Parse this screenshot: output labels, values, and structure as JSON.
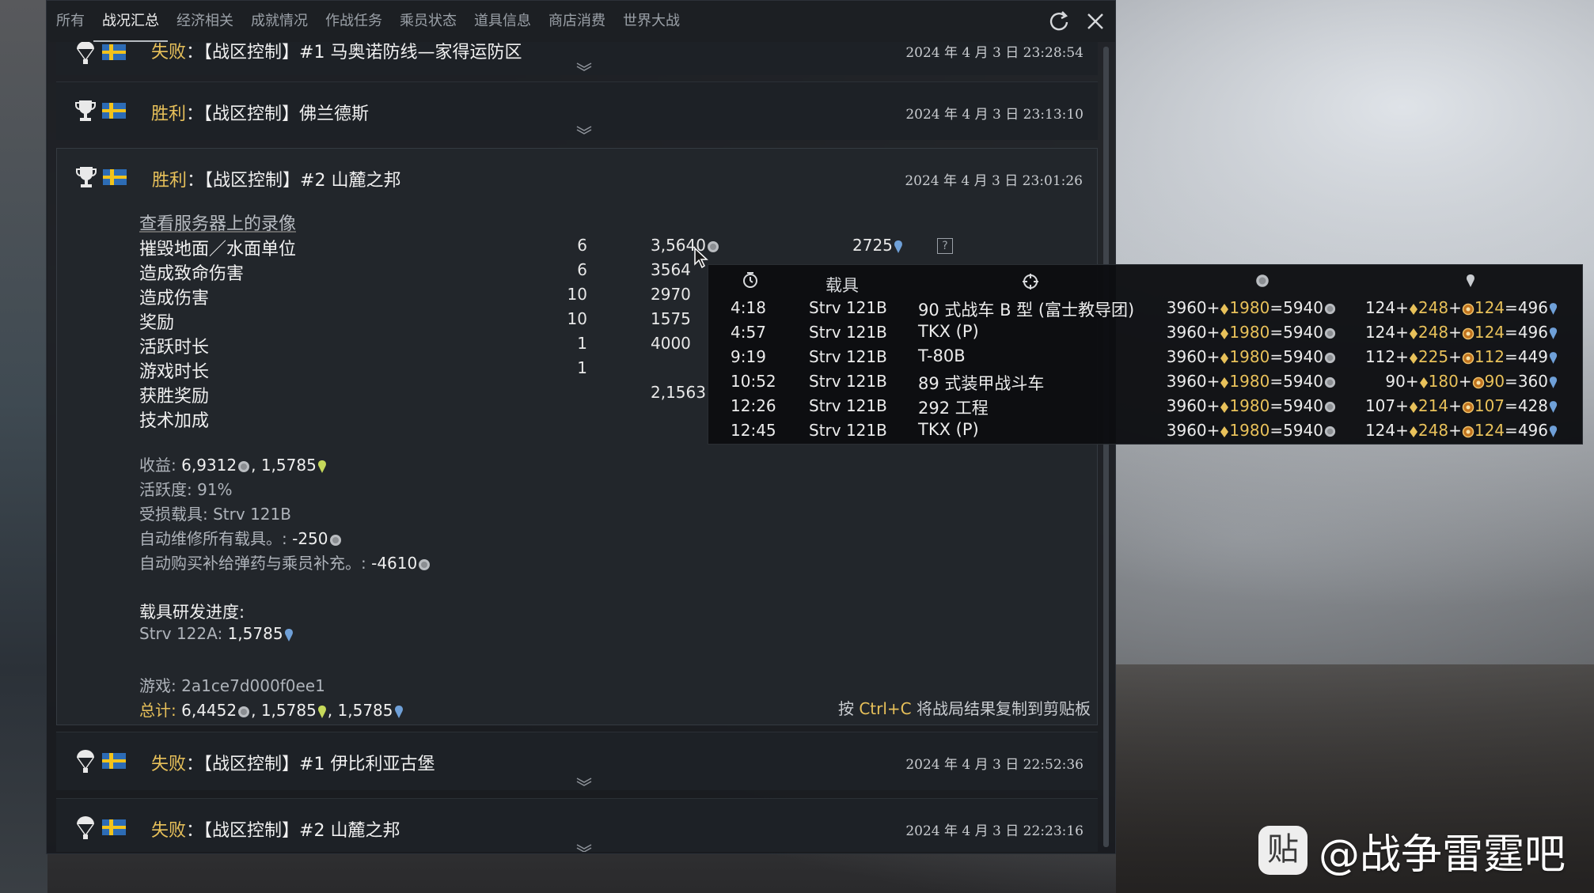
{
  "tabs": [
    "所有",
    "战况汇总",
    "经济相关",
    "成就情况",
    "作战任务",
    "乘员状态",
    "道具信息",
    "商店消费",
    "世界大战"
  ],
  "active_tab": "战况汇总",
  "colors": {
    "accent_gold": "#e8c15a",
    "rp_blue": "#6fa0d8",
    "window_bg": "#181b1f"
  },
  "entries": [
    {
      "result": "失败",
      "mission": "【战区控制】#1 马奥诺防线—家得运防区",
      "datetime": "2024 年 4 月 3 日 23:28:54",
      "icon": "parachute-icon"
    },
    {
      "result": "胜利",
      "mission": "【战区控制】佛兰德斯",
      "datetime": "2024 年 4 月 3 日 23:13:10",
      "icon": "trophy-icon"
    },
    {
      "result": "胜利",
      "mission": "【战区控制】#2 山麓之邦",
      "datetime": "2024 年 4 月 3 日 23:01:26",
      "icon": "trophy-icon"
    },
    {
      "result": "失败",
      "mission": "【战区控制】#1 伊比利亚古堡",
      "datetime": "2024 年 4 月 3 日 22:52:36",
      "icon": "parachute-icon"
    },
    {
      "result": "失败",
      "mission": "【战区控制】#2 山麓之邦",
      "datetime": "2024 年 4 月 3 日 22:23:16",
      "icon": "parachute-icon"
    }
  ],
  "separator": "：",
  "detail": {
    "replay_link": "查看服务器上的录像",
    "stats": [
      {
        "label": "摧毁地面／水面单位",
        "count": "6",
        "sl": "3,5640",
        "rp": "2725"
      },
      {
        "label": "造成致命伤害",
        "count": "6",
        "sl": "3564"
      },
      {
        "label": "造成伤害",
        "count": "10",
        "sl": "2970"
      },
      {
        "label": "奖励",
        "count": "10",
        "sl": "1575"
      },
      {
        "label": "活跃时长",
        "count": "1",
        "sl": "4000"
      },
      {
        "label": "游戏时长",
        "count": "1"
      },
      {
        "label": "获胜奖励",
        "sl": "2,1563"
      },
      {
        "label": "技术加成"
      }
    ],
    "income_label": "收益:",
    "income_value": "6,9312",
    "income_rp": "1,5785",
    "activity_label": "活跃度:",
    "activity_value": "91%",
    "damaged_label": "受损载具:",
    "damaged_value": "Strv 121B",
    "repair_label": "自动维修所有载具。:",
    "repair_value": "-250",
    "resupply_label": "自动购买补给弹药与乘员补充。:",
    "resupply_value": "-4610",
    "research_title": "载具研发进度:",
    "research_vehicle": "Strv 122A:",
    "research_value": "1,5785",
    "game_label": "游戏:",
    "game_id": "2a1ce7d000f0ee1",
    "total_label": "总计:",
    "total_sl": "6,4452",
    "total_rp1": "1,5785",
    "total_rp2": "1,5785",
    "copy_hint_prefix": "按",
    "copy_hint_key": "Ctrl+C",
    "copy_hint_suffix": "将战局结果复制到剪贴板"
  },
  "tooltip": {
    "header_vehicle": "载具",
    "rows": [
      {
        "time": "4:18",
        "vehicle": "Strv 121B",
        "target": "90 式战车 B 型 (富士教导团)",
        "sl_base": "3960",
        "sl_bonus": "1980",
        "sl_total": "5940",
        "rp_base": "124",
        "rp_b1": "248",
        "rp_b2": "124",
        "rp_total": "496"
      },
      {
        "time": "4:57",
        "vehicle": "Strv 121B",
        "target": "TKX (P)",
        "sl_base": "3960",
        "sl_bonus": "1980",
        "sl_total": "5940",
        "rp_base": "124",
        "rp_b1": "248",
        "rp_b2": "124",
        "rp_total": "496"
      },
      {
        "time": "9:19",
        "vehicle": "Strv 121B",
        "target": "T-80B",
        "sl_base": "3960",
        "sl_bonus": "1980",
        "sl_total": "5940",
        "rp_base": "112",
        "rp_b1": "225",
        "rp_b2": "112",
        "rp_total": "449"
      },
      {
        "time": "10:52",
        "vehicle": "Strv 121B",
        "target": "89 式装甲战斗车",
        "sl_base": "3960",
        "sl_bonus": "1980",
        "sl_total": "5940",
        "rp_base": "90",
        "rp_b1": "180",
        "rp_b2": "90",
        "rp_total": "360"
      },
      {
        "time": "12:26",
        "vehicle": "Strv 121B",
        "target": "292 工程",
        "sl_base": "3960",
        "sl_bonus": "1980",
        "sl_total": "5940",
        "rp_base": "107",
        "rp_b1": "214",
        "rp_b2": "107",
        "rp_total": "428"
      },
      {
        "time": "12:45",
        "vehicle": "Strv 121B",
        "target": "TKX (P)",
        "sl_base": "3960",
        "sl_bonus": "1980",
        "sl_total": "5940",
        "rp_base": "124",
        "rp_b1": "248",
        "rp_b2": "124",
        "rp_total": "496"
      }
    ]
  },
  "watermark": {
    "logo": "贴",
    "text": "@战争雷霆吧"
  }
}
